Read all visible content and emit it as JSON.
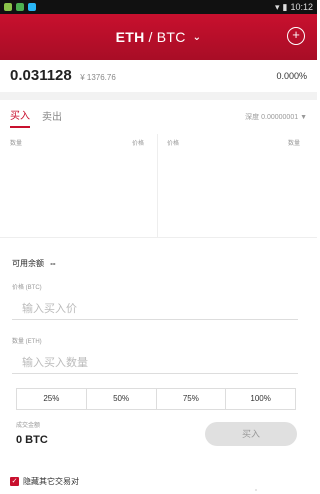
{
  "statusbar": {
    "time": "10:12",
    "signal_icon": "signal-icon",
    "battery_icon": "battery-icon"
  },
  "header": {
    "base": "ETH",
    "separator": "/",
    "quote": "BTC",
    "chevron_icon": "chevron-down-icon",
    "add_icon": "plus-circle-icon",
    "color": "#c8102e"
  },
  "price": {
    "last": "0.031128",
    "fiat": "¥ 1376.76",
    "change": "0.000%"
  },
  "tabs": {
    "buy": "买入",
    "sell": "卖出",
    "depth": "深度 0.00000001"
  },
  "orderbook": {
    "left_qty": "数量",
    "left_price": "价格",
    "right_price": "价格",
    "right_qty": "数量"
  },
  "form": {
    "available_label": "可用余额",
    "available_value": "--",
    "price_label": "价格 (BTC)",
    "price_placeholder": "输入买入价",
    "qty_label": "数量 (ETH)",
    "qty_placeholder": "输入买入数量",
    "pcts": [
      "25%",
      "50%",
      "75%",
      "100%"
    ],
    "total_label": "成交金额",
    "total_value": "0 BTC",
    "buy_button": "买入"
  },
  "footer": {
    "hide_others": "隐藏其它交易对"
  }
}
